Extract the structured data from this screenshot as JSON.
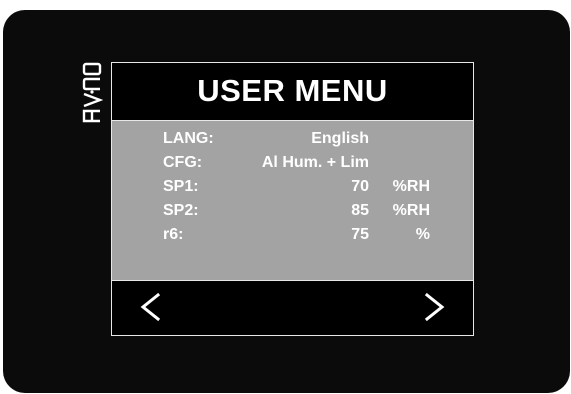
{
  "brand": {
    "logo_text": "EVCO"
  },
  "menu": {
    "title": "USER MENU",
    "rows": [
      {
        "label": "LANG:",
        "value": "English",
        "unit": ""
      },
      {
        "label": "CFG:",
        "value": "Al Hum. + Lim",
        "unit": ""
      },
      {
        "label": "SP1:",
        "value": "70",
        "unit": "%RH"
      },
      {
        "label": "SP2:",
        "value": "85",
        "unit": "%RH"
      },
      {
        "label": "r6:",
        "value": "75",
        "unit": "%"
      }
    ]
  },
  "nav": {
    "prev_icon": "chevron-left-icon",
    "next_icon": "chevron-right-icon"
  },
  "colors": {
    "bezel": "#0b0b0b",
    "panel": "#a3a3a3",
    "text": "#ffffff",
    "border": "#e8e8e8"
  }
}
